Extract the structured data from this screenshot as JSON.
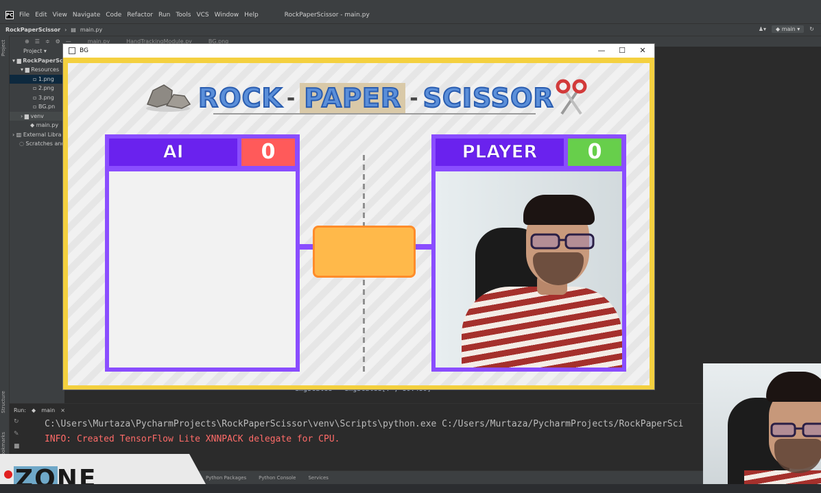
{
  "ide": {
    "menu": [
      "File",
      "Edit",
      "View",
      "Navigate",
      "Code",
      "Refactor",
      "Run",
      "Tools",
      "VCS",
      "Window",
      "Help"
    ],
    "window_title": "RockPaperScissor - main.py",
    "breadcrumb": {
      "project": "RockPaperScissor",
      "file": "main.py"
    },
    "branch": "main",
    "tabs": [
      "main.py",
      "HandTrackingModule.py",
      "BG.png"
    ],
    "tree": {
      "project_label": "Project",
      "root": "RockPaperSci",
      "resources": "Resources",
      "files": [
        "1.png",
        "2.png",
        "3.png",
        "BG.pn"
      ],
      "venv": "venv",
      "main": "main.py",
      "external": "External Libra",
      "scratches": "Scratches and"
    },
    "code_line": "imgScaled = imgScaled[: , 80:480]",
    "run": {
      "label": "Run:",
      "config": "main",
      "line1": "C:\\Users\\Murtaza\\PycharmProjects\\RockPaperScissor\\venv\\Scripts\\python.exe C:/Users/Murtaza/PycharmProjects/RockPaperSci",
      "line2": "INFO: Created TensorFlow Lite XNNPACK delegate for CPU."
    },
    "bottom_tabs": [
      "Python Packages",
      "Python Console",
      "Services"
    ],
    "side_labels": {
      "project": "Project",
      "structure": "Structure",
      "bookmarks": "Bookmarks"
    },
    "watermark": "ZONE"
  },
  "game": {
    "window_title": "BG",
    "controls": {
      "min": "—",
      "max": "☐",
      "close": "✕"
    },
    "title": {
      "rock": "ROCK",
      "paper": "PAPER",
      "scissor": "SCISSOR",
      "dash": "-"
    },
    "ai": {
      "label": "AI",
      "score": "0"
    },
    "player": {
      "label": "PLAYER",
      "score": "0"
    }
  },
  "colors": {
    "frame": "#f4d03f",
    "panel": "#8a4dff",
    "panel_header": "#6a22ee",
    "ai_score": "#ff5a5a",
    "player_score": "#67cf4b",
    "center_box": "#ffb94a"
  }
}
